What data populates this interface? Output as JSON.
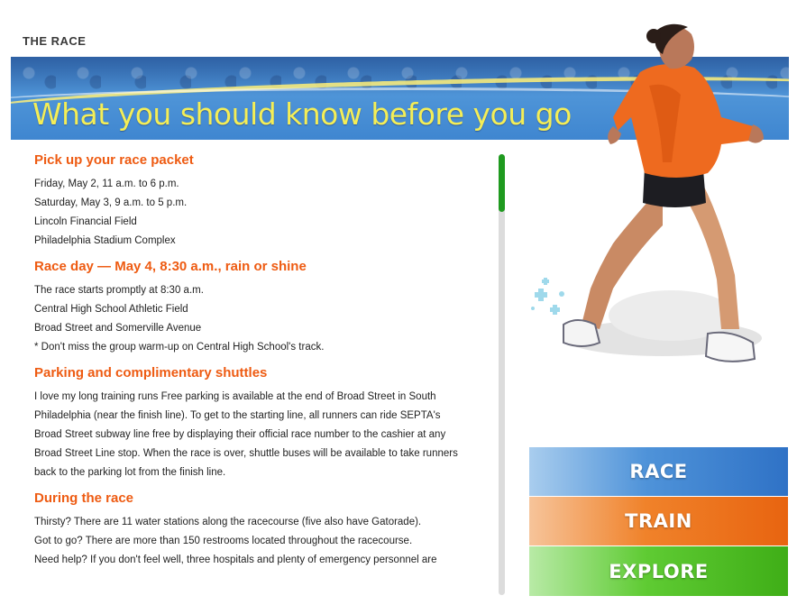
{
  "section_label": "THE RACE",
  "banner": {
    "title": "What you should know before you go"
  },
  "sections": {
    "packet": {
      "heading": "Pick up your race packet",
      "lines": [
        "Friday, May 2, 11 a.m. to 6 p.m.",
        "Saturday, May 3, 9 a.m. to 5 p.m.",
        "Lincoln Financial Field",
        "Philadelphia Stadium Complex"
      ]
    },
    "raceday": {
      "heading": "Race day — May 4, 8:30 a.m., rain or shine",
      "lines": [
        "The race starts promptly at 8:30 a.m.",
        "Central High School Athletic Field",
        "Broad Street and Somerville Avenue",
        "* Don't miss the group warm-up on Central High School's track."
      ]
    },
    "parking": {
      "heading": "Parking and complimentary shuttles",
      "lines": [
        "I love my long training runs Free parking is available at the end of Broad Street in South",
        "Philadelphia (near the finish line). To get to the starting line, all runners can ride SEPTA's",
        "Broad Street subway line free by displaying their official race number to the cashier at any",
        "Broad Street Line stop. When the race is over, shuttle buses will be available to take runners",
        "back to the parking lot from the finish line."
      ]
    },
    "during": {
      "heading": "During the race",
      "lines": [
        "Thirsty? There are 11 water stations along the racecourse (five also have Gatorade).",
        "Got to go? There are more than 150 restrooms located throughout the racecourse.",
        "Need help? If you don't feel well, three hospitals and plenty of emergency personnel are"
      ]
    }
  },
  "nav": {
    "race": "RACE",
    "train": "TRAIN",
    "explore": "EXPLORE"
  },
  "colors": {
    "heading_orange": "#ee5b12",
    "banner_blue": "#4f95d8",
    "banner_text": "#f4ee57",
    "scroll_thumb": "#1f9a1f"
  }
}
